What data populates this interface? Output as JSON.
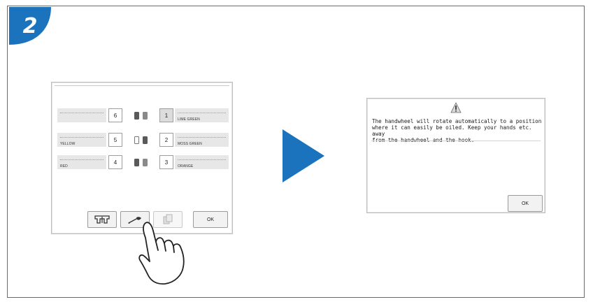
{
  "step_number": "2",
  "colors": {
    "accent": "#1b73be",
    "field_bg": "#e7e7e7",
    "border": "#9d9d9d"
  },
  "left_screen": {
    "rows": [
      {
        "left_name": "",
        "left_num": "6",
        "spools": [
          "dark",
          "mid"
        ],
        "right_num": "1",
        "right_name": "LIME GREEN",
        "right_pressed": true
      },
      {
        "left_name": "YELLOW",
        "left_num": "5",
        "spools": [
          "empty",
          "dark"
        ],
        "right_num": "2",
        "right_name": "MOSS GREEN",
        "right_pressed": false
      },
      {
        "left_name": "RED",
        "left_num": "4",
        "spools": [
          "dark",
          "mid"
        ],
        "right_num": "3",
        "right_name": "ORANGE",
        "right_pressed": false
      }
    ],
    "toolbar": {
      "button1_icon": "presser-foot-icon",
      "button2_icon": "oil-can-icon",
      "button3_icon": "copy-pages-icon",
      "ok_label": "OK"
    }
  },
  "arrow_icon": "right-arrow-icon",
  "right_screen": {
    "icon": "warning-icon",
    "message": "The handwheel will rotate automatically to a position\nwhere it can easily be oiled. Keep your hands etc. away\nfrom the handwheel and the hook.",
    "ok_label": "OK"
  },
  "hand_icon": "pointing-hand-icon"
}
